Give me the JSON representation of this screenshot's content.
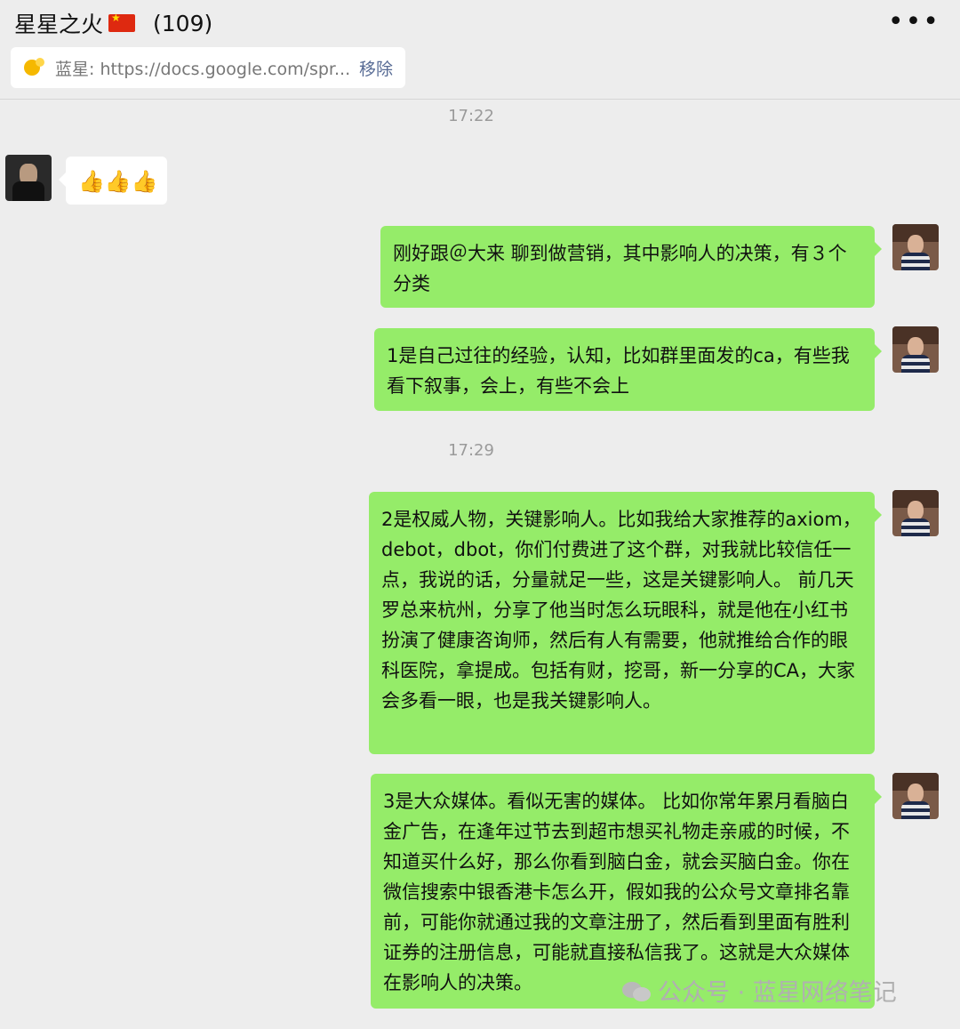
{
  "header": {
    "chat_name": "星星之火",
    "member_count": "(109)",
    "more_icon": "more-dots-icon"
  },
  "pinned": {
    "text": "蓝星: https://docs.google.com/spr...",
    "remove_label": "移除"
  },
  "timestamps": [
    "17:22",
    "17:29"
  ],
  "messages": [
    {
      "from": "other",
      "content": "👍👍👍"
    },
    {
      "from": "me",
      "content": "刚好跟＠大来 聊到做营销，其中影响人的决策，有３个分类"
    },
    {
      "from": "me",
      "content": "1是自己过往的经验，认知，比如群里面发的ca，有些我看下叙事，会上，有些不会上"
    },
    {
      "from": "me",
      "content": "2是权威人物，关键影响人。比如我给大家推荐的axiom，debot，dbot，你们付费进了这个群，对我就比较信任一点，我说的话，分量就足一些，这是关键影响人。 前几天罗总来杭州，分享了他当时怎么玩眼科，就是他在小红书扮演了健康咨询师，然后有人有需要，他就推给合作的眼科医院，拿提成。包括有财，挖哥，新一分享的CA，大家会多看一眼，也是我关键影响人。"
    },
    {
      "from": "me",
      "content": "3是大众媒体。看似无害的媒体。 比如你常年累月看脑白金广告，在逢年过节去到超市想买礼物走亲戚的时候，不知道买什么好，那么你看到脑白金，就会买脑白金。你在微信搜索中银香港卡怎么开，假如我的公众号文章排名靠前，可能你就通过我的文章注册了，然后看到里面有胜利证券的注册信息，可能就直接私信我了。这就是大众媒体在影响人的决策。"
    }
  ],
  "watermark": "公众号 · 蓝星网络笔记"
}
